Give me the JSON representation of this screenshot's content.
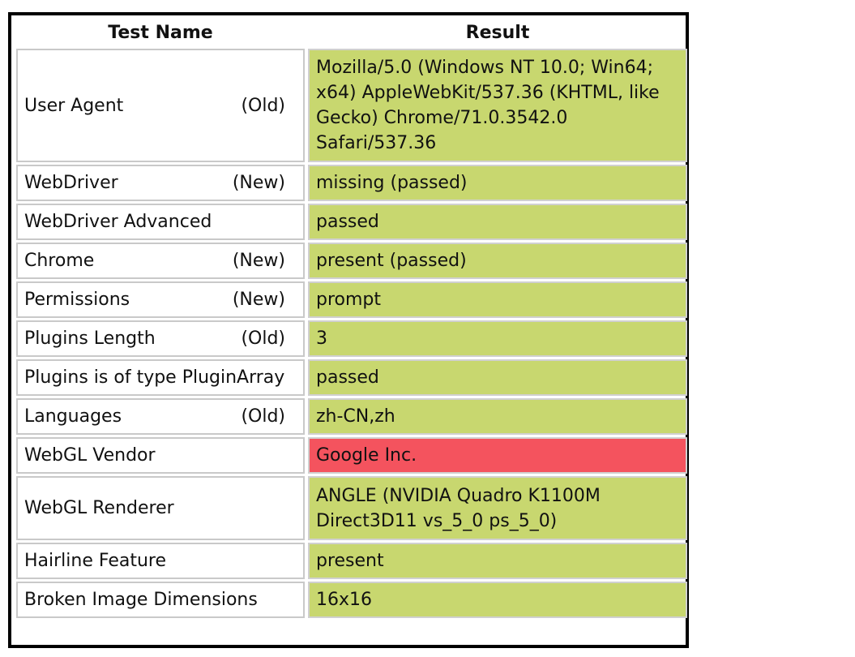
{
  "table": {
    "header": {
      "name": "Test Name",
      "result": "Result"
    },
    "rows": [
      {
        "name": "User Agent",
        "tag": "(Old)",
        "result": "Mozilla/5.0 (Windows NT 10.0; Win64; x64) AppleWebKit/537.36 (KHTML, like Gecko) Chrome/71.0.3542.0 Safari/537.36",
        "status": "passed"
      },
      {
        "name": "WebDriver",
        "tag": "(New)",
        "result": "missing (passed)",
        "status": "passed"
      },
      {
        "name": "WebDriver Advanced",
        "tag": "",
        "result": "passed",
        "status": "passed"
      },
      {
        "name": "Chrome",
        "tag": "(New)",
        "result": "present (passed)",
        "status": "passed"
      },
      {
        "name": "Permissions",
        "tag": "(New)",
        "result": "prompt",
        "status": "passed"
      },
      {
        "name": "Plugins Length",
        "tag": "(Old)",
        "result": "3",
        "status": "passed"
      },
      {
        "name": "Plugins is of type PluginArray",
        "tag": "",
        "result": "passed",
        "status": "passed"
      },
      {
        "name": "Languages",
        "tag": "(Old)",
        "result": "zh-CN,zh",
        "status": "passed"
      },
      {
        "name": "WebGL Vendor",
        "tag": "",
        "result": "Google Inc.",
        "status": "failed"
      },
      {
        "name": "WebGL Renderer",
        "tag": "",
        "result": "ANGLE (NVIDIA Quadro K1100M Direct3D11 vs_5_0 ps_5_0)",
        "status": "passed"
      },
      {
        "name": "Hairline Feature",
        "tag": "",
        "result": "present",
        "status": "passed"
      },
      {
        "name": "Broken Image Dimensions",
        "tag": "",
        "result": "16x16",
        "status": "passed"
      }
    ]
  },
  "colors": {
    "passed": "#c8d76f",
    "failed": "#f4535e",
    "border": "#000000"
  }
}
